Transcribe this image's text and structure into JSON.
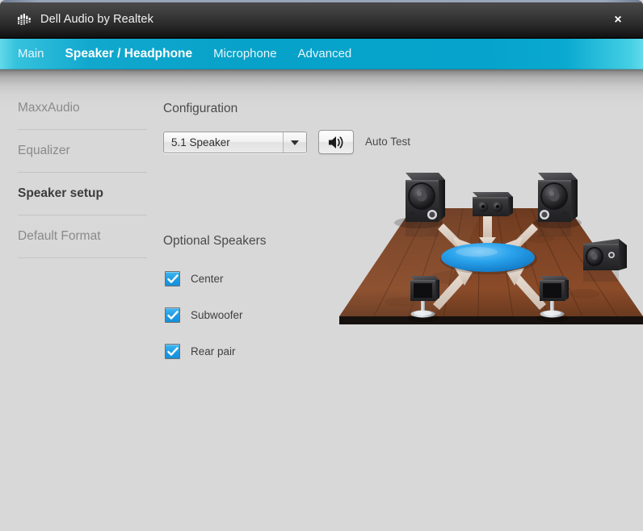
{
  "window": {
    "title": "Dell Audio by Realtek",
    "app_icon": "equalizer-bars-icon",
    "close_label": "×"
  },
  "nav": {
    "items": [
      {
        "label": "Main",
        "active": false
      },
      {
        "label": "Speaker / Headphone",
        "active": true
      },
      {
        "label": "Microphone",
        "active": false
      },
      {
        "label": "Advanced",
        "active": false
      }
    ]
  },
  "sidebar": {
    "items": [
      {
        "label": "MaxxAudio",
        "active": false
      },
      {
        "label": "Equalizer",
        "active": false
      },
      {
        "label": "Speaker setup",
        "active": true
      },
      {
        "label": "Default Format",
        "active": false
      }
    ]
  },
  "main": {
    "configuration": {
      "title": "Configuration",
      "selected": "5.1 Speaker",
      "options": [
        "5.1 Speaker"
      ],
      "test_button_icon": "speaker-volume-icon",
      "test_label": "Auto Test"
    },
    "optional_speakers": {
      "title": "Optional Speakers",
      "items": [
        {
          "label": "Center",
          "checked": true
        },
        {
          "label": "Subwoofer",
          "checked": true
        },
        {
          "label": "Rear pair",
          "checked": true
        }
      ]
    },
    "diagram": {
      "name": "5.1-speaker-layout-diagram",
      "floor": "wood",
      "listener": "blue-ellipse",
      "speakers": [
        "front-left-speaker",
        "center-speaker",
        "front-right-speaker",
        "subwoofer",
        "rear-left-speaker",
        "rear-right-speaker"
      ]
    }
  },
  "colors": {
    "nav_teal": "#07a2c9",
    "nav_teal_light": "#62d9ea",
    "checkbox_blue": "#1f9ae2",
    "content_bg": "#d8d8d8",
    "titlebar_black": "#111111",
    "wood_floor": "#7b4226",
    "listener_blue": "#2196e8"
  }
}
